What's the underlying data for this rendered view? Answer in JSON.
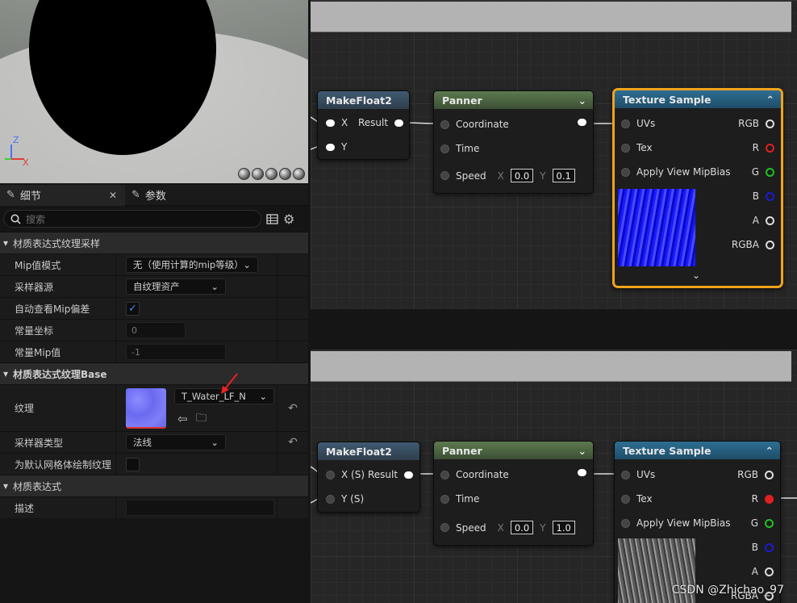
{
  "details": {
    "tab_details": "细节",
    "tab_params": "参数",
    "search_placeholder": "搜索",
    "sections": {
      "sample": "材质表达式纹理采样",
      "base": "材质表达式纹理Base",
      "expr": "材质表达式"
    },
    "props": {
      "mip_mode_label": "Mip值模式",
      "mip_mode_value": "无（使用计算的mip等级）",
      "sampler_source_label": "采样器源",
      "sampler_source_value": "自纹理资产",
      "auto_mip_label": "自动查看Mip偏差",
      "const_coord_label": "常量坐标",
      "const_coord_value": "0",
      "const_mip_label": "常量Mip值",
      "const_mip_value": "-1",
      "texture_label": "纹理",
      "texture_value": "T_Water_LF_N",
      "sampler_type_label": "采样器类型",
      "sampler_type_value": "法线",
      "default_mesh_label": "为默认网格体绘制纹理",
      "desc_label": "描述",
      "desc_value": ""
    }
  },
  "graph_top": {
    "makefloat": {
      "title": "MakeFloat2",
      "x": "X",
      "y": "Y",
      "result": "Result"
    },
    "panner": {
      "title": "Panner",
      "coordinate": "Coordinate",
      "time": "Time",
      "speed": "Speed",
      "sx_label": "X",
      "sx": "0.0",
      "sy_label": "Y",
      "sy": "0.1"
    },
    "texture": {
      "title": "Texture Sample",
      "uvs": "UVs",
      "tex": "Tex",
      "mip": "Apply View MipBias",
      "rgb": "RGB",
      "r": "R",
      "g": "G",
      "b": "B",
      "a": "A",
      "rgba": "RGBA"
    }
  },
  "graph_bottom": {
    "makefloat": {
      "title": "MakeFloat2",
      "x": "X (S)",
      "y": "Y (S)",
      "result": "Result"
    },
    "panner": {
      "title": "Panner",
      "coordinate": "Coordinate",
      "time": "Time",
      "speed": "Speed",
      "sx_label": "X",
      "sx": "0.0",
      "sy_label": "Y",
      "sy": "1.0"
    },
    "texture": {
      "title": "Texture Sample",
      "uvs": "UVs",
      "tex": "Tex",
      "mip": "Apply View MipBias",
      "rgb": "RGB",
      "r": "R",
      "g": "G",
      "b": "B",
      "a": "A",
      "rgba": "RGBA"
    }
  },
  "colors": {
    "selection": "#f2a31a",
    "r": "#e02020",
    "g": "#20c020",
    "b": "#1b1bd6",
    "accent": "#3b8cff"
  },
  "watermark": "CSDN @Zhichao_97"
}
